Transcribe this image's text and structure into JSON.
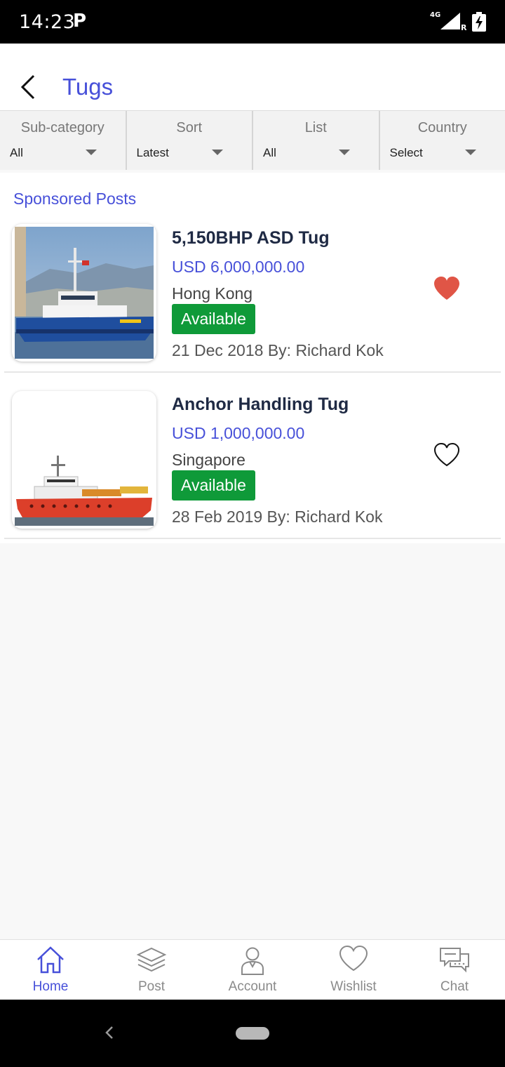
{
  "status_bar": {
    "time": "14:23",
    "notification": "P",
    "network": "4G",
    "roaming": "R"
  },
  "header": {
    "title": "Tugs"
  },
  "filters": [
    {
      "label": "Sub-category",
      "value": "All"
    },
    {
      "label": "Sort",
      "value": "Latest"
    },
    {
      "label": "List",
      "value": "All"
    },
    {
      "label": "Country",
      "value": "Select"
    }
  ],
  "section_title": "Sponsored Posts",
  "posts": [
    {
      "title": "5,150BHP ASD Tug",
      "price": "USD  6,000,000.00",
      "location": "Hong Kong",
      "status": "Available",
      "meta": "21 Dec 2018 By: Richard Kok",
      "favorited": true
    },
    {
      "title": "Anchor Handling Tug",
      "price": "USD  1,000,000.00",
      "location": "Singapore",
      "status": "Available",
      "meta": "28 Feb 2019 By: Richard Kok",
      "favorited": false
    }
  ],
  "nav": [
    {
      "label": "Home",
      "icon": "home-icon",
      "active": true
    },
    {
      "label": "Post",
      "icon": "layers-icon",
      "active": false
    },
    {
      "label": "Account",
      "icon": "person-icon",
      "active": false
    },
    {
      "label": "Wishlist",
      "icon": "heart-icon",
      "active": false
    },
    {
      "label": "Chat",
      "icon": "chat-icon",
      "active": false
    }
  ],
  "colors": {
    "accent": "#4750d9",
    "available": "#0f9a39",
    "favorite": "#e05546"
  }
}
